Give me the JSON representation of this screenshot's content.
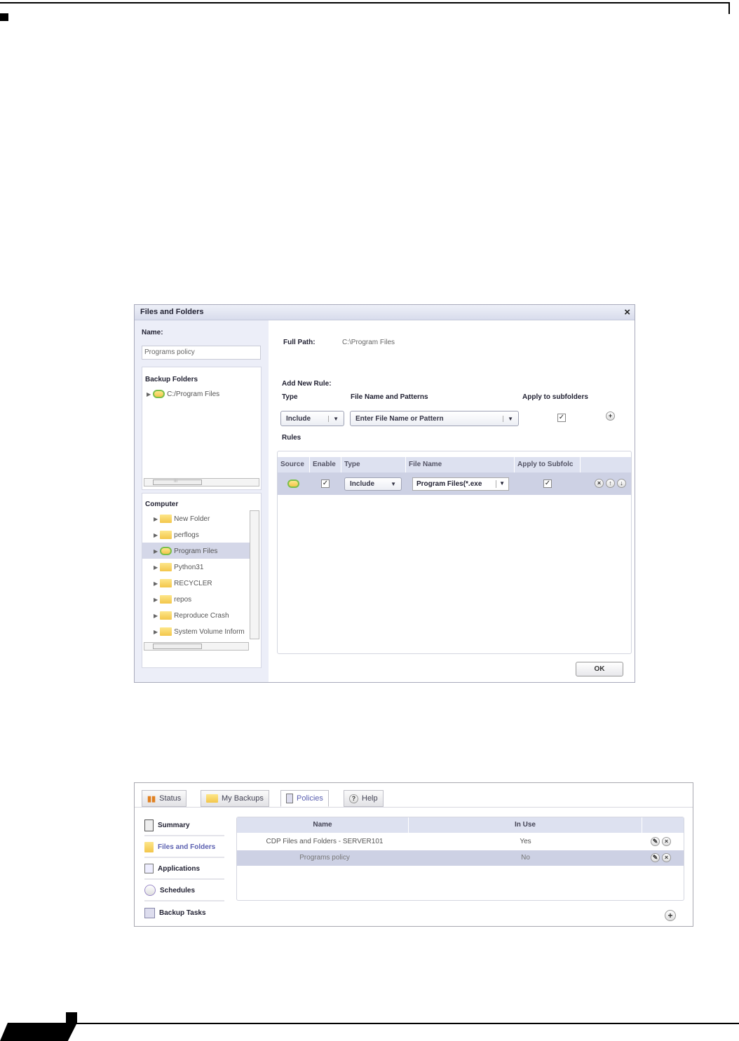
{
  "dialog": {
    "title": "Files and Folders",
    "name_label": "Name:",
    "name_value": "Programs policy",
    "backup_folders_label": "Backup Folders",
    "backup_folders": [
      "C:/Program Files"
    ],
    "computer_label": "Computer",
    "computer_items": [
      "New Folder",
      "perflogs",
      "Program Files",
      "Python31",
      "RECYCLER",
      "repos",
      "Reproduce Crash",
      "System Volume Inform"
    ],
    "selected_computer_item": "Program Files",
    "full_path_label": "Full Path:",
    "full_path_value": "C:\\Program Files",
    "add_rule_label": "Add New Rule:",
    "type_label": "Type",
    "pattern_label": "File Name and Patterns",
    "apply_label": "Apply to subfolders",
    "type_value": "Include",
    "pattern_placeholder": "Enter File Name or Pattern",
    "rules_label": "Rules",
    "columns": [
      "Source",
      "Enable",
      "Type",
      "File Name",
      "Apply to Subfolc"
    ],
    "rule": {
      "type": "Include",
      "file_name": "Program Files(*.exe"
    },
    "ok_label": "OK",
    "scroll_grip": "III"
  },
  "policies": {
    "tabs": [
      "Status",
      "My Backups",
      "Policies",
      "Help"
    ],
    "active_tab": "Policies",
    "nav": [
      "Summary",
      "Files and Folders",
      "Applications",
      "Schedules",
      "Backup Tasks"
    ],
    "active_nav": "Files and Folders",
    "columns": [
      "Name",
      "In Use"
    ],
    "rows": [
      {
        "name": "CDP Files and Folders - SERVER101",
        "in_use": "Yes"
      },
      {
        "name": "Programs policy",
        "in_use": "No"
      }
    ]
  },
  "colors": {
    "accent": "#5a5fb0",
    "row_selected": "#cdd1e4",
    "header": "#dde1f0"
  }
}
